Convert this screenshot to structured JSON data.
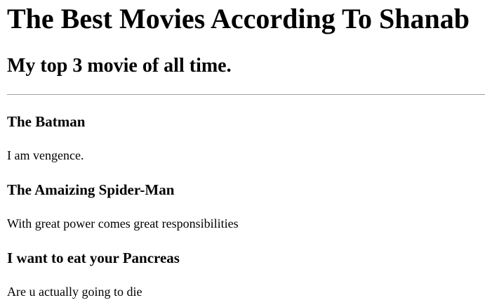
{
  "page": {
    "title": "The Best Movies According To Shanab",
    "subtitle": "My top 3 movie of all time."
  },
  "movies": [
    {
      "title": "The Batman",
      "description": "I am vengence."
    },
    {
      "title": "The Amaizing Spider-Man",
      "description": "With great power comes great responsibilities"
    },
    {
      "title": "I want to eat your Pancreas",
      "description": "Are u actually going to die"
    }
  ]
}
